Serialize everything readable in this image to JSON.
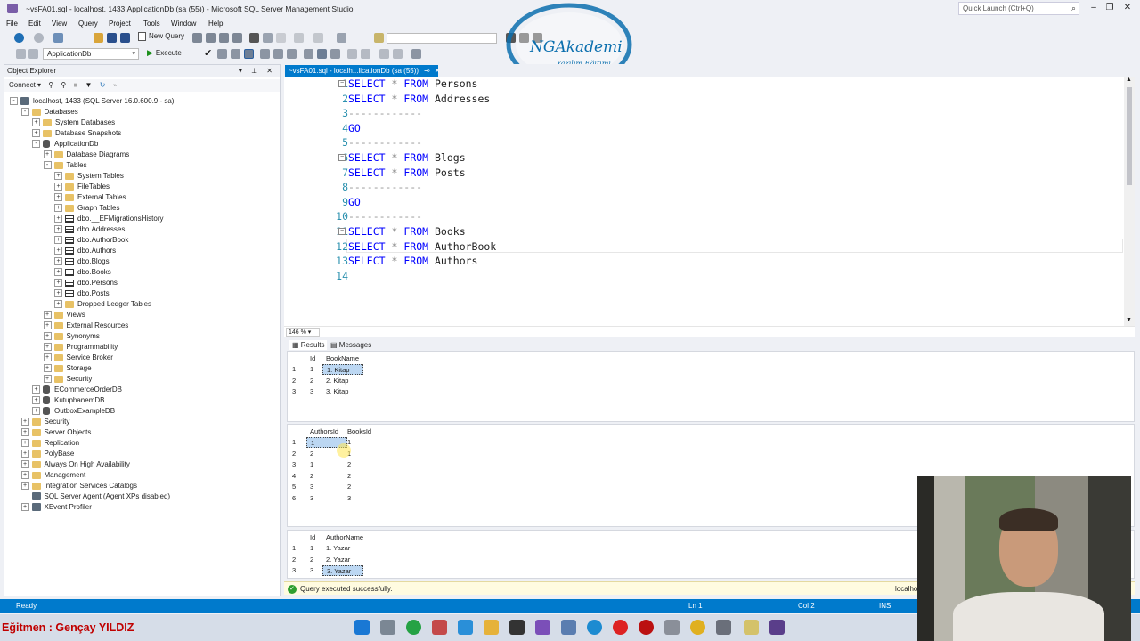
{
  "window": {
    "title": "~vsFA01.sql - localhost, 1433.ApplicationDb (sa (55)) - Microsoft SQL Server Management Studio",
    "quick_launch_placeholder": "Quick Launch (Ctrl+Q)"
  },
  "menu": [
    "File",
    "Edit",
    "View",
    "Query",
    "Project",
    "Tools",
    "Window",
    "Help"
  ],
  "toolbar": {
    "new_query": "New Query",
    "database": "ApplicationDb",
    "execute": "Execute"
  },
  "object_explorer": {
    "title": "Object Explorer",
    "connect": "Connect",
    "tree": [
      {
        "label": "localhost, 1433 (SQL Server 16.0.600.9 - sa)",
        "level": 0,
        "icon": "server-icon",
        "exp": "-"
      },
      {
        "label": "Databases",
        "level": 1,
        "icon": "folder-icon",
        "exp": "-"
      },
      {
        "label": "System Databases",
        "level": 2,
        "icon": "folder-icon",
        "exp": "+"
      },
      {
        "label": "Database Snapshots",
        "level": 2,
        "icon": "folder-icon",
        "exp": "+"
      },
      {
        "label": "ApplicationDb",
        "level": 2,
        "icon": "database-icon",
        "exp": "-"
      },
      {
        "label": "Database Diagrams",
        "level": 3,
        "icon": "folder-icon",
        "exp": "+"
      },
      {
        "label": "Tables",
        "level": 3,
        "icon": "folder-icon",
        "exp": "-"
      },
      {
        "label": "System Tables",
        "level": 4,
        "icon": "folder-icon",
        "exp": "+"
      },
      {
        "label": "FileTables",
        "level": 4,
        "icon": "folder-icon",
        "exp": "+"
      },
      {
        "label": "External Tables",
        "level": 4,
        "icon": "folder-icon",
        "exp": "+"
      },
      {
        "label": "Graph Tables",
        "level": 4,
        "icon": "folder-icon",
        "exp": "+"
      },
      {
        "label": "dbo.__EFMigrationsHistory",
        "level": 4,
        "icon": "table-icon",
        "exp": "+"
      },
      {
        "label": "dbo.Addresses",
        "level": 4,
        "icon": "table-icon",
        "exp": "+"
      },
      {
        "label": "dbo.AuthorBook",
        "level": 4,
        "icon": "table-icon",
        "exp": "+"
      },
      {
        "label": "dbo.Authors",
        "level": 4,
        "icon": "table-icon",
        "exp": "+"
      },
      {
        "label": "dbo.Blogs",
        "level": 4,
        "icon": "table-icon",
        "exp": "+"
      },
      {
        "label": "dbo.Books",
        "level": 4,
        "icon": "table-icon",
        "exp": "+"
      },
      {
        "label": "dbo.Persons",
        "level": 4,
        "icon": "table-icon",
        "exp": "+"
      },
      {
        "label": "dbo.Posts",
        "level": 4,
        "icon": "table-icon",
        "exp": "+"
      },
      {
        "label": "Dropped Ledger Tables",
        "level": 4,
        "icon": "folder-icon",
        "exp": "+"
      },
      {
        "label": "Views",
        "level": 3,
        "icon": "folder-icon",
        "exp": "+"
      },
      {
        "label": "External Resources",
        "level": 3,
        "icon": "folder-icon",
        "exp": "+"
      },
      {
        "label": "Synonyms",
        "level": 3,
        "icon": "folder-icon",
        "exp": "+"
      },
      {
        "label": "Programmability",
        "level": 3,
        "icon": "folder-icon",
        "exp": "+"
      },
      {
        "label": "Service Broker",
        "level": 3,
        "icon": "folder-icon",
        "exp": "+"
      },
      {
        "label": "Storage",
        "level": 3,
        "icon": "folder-icon",
        "exp": "+"
      },
      {
        "label": "Security",
        "level": 3,
        "icon": "folder-icon",
        "exp": "+"
      },
      {
        "label": "ECommerceOrderDB",
        "level": 2,
        "icon": "database-icon",
        "exp": "+"
      },
      {
        "label": "KutuphanemDB",
        "level": 2,
        "icon": "database-icon",
        "exp": "+"
      },
      {
        "label": "OutboxExampleDB",
        "level": 2,
        "icon": "database-icon",
        "exp": "+"
      },
      {
        "label": "Security",
        "level": 1,
        "icon": "folder-icon",
        "exp": "+"
      },
      {
        "label": "Server Objects",
        "level": 1,
        "icon": "folder-icon",
        "exp": "+"
      },
      {
        "label": "Replication",
        "level": 1,
        "icon": "folder-icon",
        "exp": "+"
      },
      {
        "label": "PolyBase",
        "level": 1,
        "icon": "folder-icon",
        "exp": "+"
      },
      {
        "label": "Always On High Availability",
        "level": 1,
        "icon": "folder-icon",
        "exp": "+"
      },
      {
        "label": "Management",
        "level": 1,
        "icon": "folder-icon",
        "exp": "+"
      },
      {
        "label": "Integration Services Catalogs",
        "level": 1,
        "icon": "folder-icon",
        "exp": "+"
      },
      {
        "label": "SQL Server Agent (Agent XPs disabled)",
        "level": 1,
        "icon": "agent-icon",
        "exp": ""
      },
      {
        "label": "XEvent Profiler",
        "level": 1,
        "icon": "profiler-icon",
        "exp": "+"
      }
    ]
  },
  "editor": {
    "tab_title": "~vsFA01.sql - localh...licationDb (sa (55))",
    "zoom": "146 %",
    "lines": [
      {
        "n": "1",
        "text": "SELECT * FROM Persons"
      },
      {
        "n": "2",
        "text": "SELECT * FROM Addresses"
      },
      {
        "n": "3",
        "text": "------------"
      },
      {
        "n": "4",
        "text": "GO"
      },
      {
        "n": "5",
        "text": "------------"
      },
      {
        "n": "6",
        "text": "SELECT * FROM Blogs"
      },
      {
        "n": "7",
        "text": "SELECT * FROM Posts"
      },
      {
        "n": "8",
        "text": "------------"
      },
      {
        "n": "9",
        "text": "GO"
      },
      {
        "n": "10",
        "text": "------------"
      },
      {
        "n": "11",
        "text": "SELECT * FROM Books"
      },
      {
        "n": "12",
        "text": "SELECT * FROM AuthorBook"
      },
      {
        "n": "13",
        "text": "SELECT * FROM Authors"
      },
      {
        "n": "14",
        "text": ""
      }
    ]
  },
  "results": {
    "tab_results": "Results",
    "tab_messages": "Messages",
    "grid1": {
      "columns": [
        "Id",
        "BookName"
      ],
      "rows": [
        [
          "1",
          "1",
          "1. Kitap"
        ],
        [
          "2",
          "2",
          "2. Kitap"
        ],
        [
          "3",
          "3",
          "3. Kitap"
        ]
      ]
    },
    "grid2": {
      "columns": [
        "AuthorsId",
        "BooksId"
      ],
      "rows": [
        [
          "1",
          "1",
          "1"
        ],
        [
          "2",
          "2",
          "1"
        ],
        [
          "3",
          "1",
          "2"
        ],
        [
          "4",
          "2",
          "2"
        ],
        [
          "5",
          "3",
          "2"
        ],
        [
          "6",
          "3",
          "3"
        ]
      ]
    },
    "grid3": {
      "columns": [
        "Id",
        "AuthorName"
      ],
      "rows": [
        [
          "1",
          "1",
          "1. Yazar"
        ],
        [
          "2",
          "2",
          "2. Yazar"
        ],
        [
          "3",
          "3",
          "3. Yazar"
        ]
      ]
    }
  },
  "query_status": {
    "message": "Query executed successfully.",
    "server": "localho"
  },
  "statusbar": {
    "ready": "Ready",
    "ln": "Ln 1",
    "col": "Col 2",
    "ins": "INS"
  },
  "caption": "Eğitmen : Gençay YILDIZ",
  "logo": {
    "brand": "NGAkademi",
    "tagline": "Yazılım Eğitimi"
  },
  "colors": {
    "accent": "#007acc",
    "keyword": "#0000ff",
    "line_number": "#2b91af",
    "caption": "#c00000"
  }
}
